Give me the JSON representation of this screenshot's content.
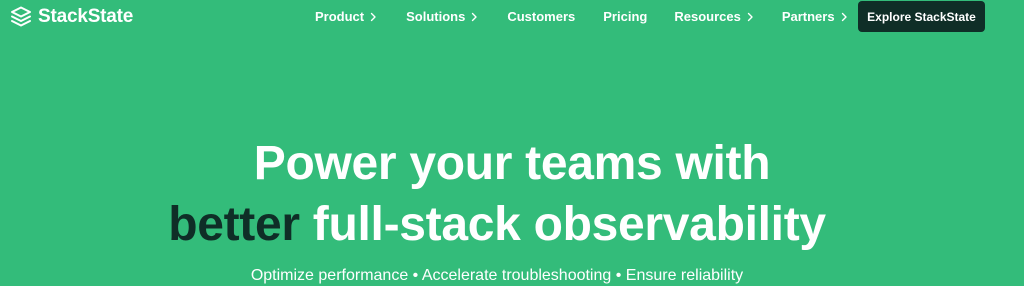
{
  "brand": {
    "name": "StackState",
    "logo_icon": "stackstate-logo-icon"
  },
  "nav": {
    "items": [
      {
        "label": "Product",
        "has_dropdown": true
      },
      {
        "label": "Solutions",
        "has_dropdown": true
      },
      {
        "label": "Customers",
        "has_dropdown": false
      },
      {
        "label": "Pricing",
        "has_dropdown": false
      },
      {
        "label": "Resources",
        "has_dropdown": true
      },
      {
        "label": "Partners",
        "has_dropdown": true
      }
    ],
    "cta_label": "Explore StackState",
    "dropdown_icon": "chevron-right-icon"
  },
  "hero": {
    "line1": "Power your teams with",
    "line2_accent": "better",
    "line2_rest": " full-stack observability",
    "subtitle": "Optimize performance • Accelerate troubleshooting • Ensure reliability"
  },
  "colors": {
    "background": "#33bc7a",
    "text": "#ffffff",
    "accent_dark": "#0f2e27"
  }
}
